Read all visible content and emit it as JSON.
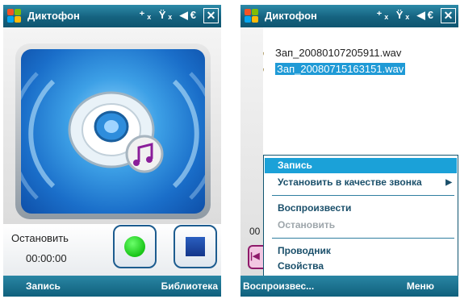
{
  "status_bar": {
    "app_title": "Диктофон",
    "icons": [
      "windows-start-icon",
      "connectivity-icon",
      "signal-off-icon",
      "volume-muted-icon",
      "close-icon"
    ],
    "status_glyphs": "⁺ₓ Ÿₓ ◀€",
    "close_glyph": "✕"
  },
  "left_screen": {
    "status_text": "Остановить",
    "elapsed_time": "00:00:00",
    "controls": {
      "record_icon": "record-dot-icon",
      "stop_icon": "stop-square-icon"
    },
    "softkeys": {
      "left": "Запись",
      "right": "Библиотека"
    }
  },
  "right_screen": {
    "files": [
      {
        "name": "Зап_20080107205911.wav",
        "selected": false
      },
      {
        "name": "Зап_20080715163151.wav",
        "selected": true
      }
    ],
    "peek_text": "00",
    "context_menu": {
      "items": [
        {
          "label": "Запись",
          "state": "highlighted"
        },
        {
          "label": "Установить в качестве звонка",
          "state": "normal",
          "submenu": true
        },
        {
          "label": "Воспроизвести",
          "state": "normal"
        },
        {
          "label": "Остановить",
          "state": "disabled"
        },
        {
          "label": "Проводник",
          "state": "normal"
        },
        {
          "label": "Свойства",
          "state": "normal"
        }
      ]
    },
    "softkeys": {
      "left": "Воспроизвес...",
      "right": "Меню"
    }
  },
  "colors": {
    "titlebar": "#15627f",
    "highlight": "#1ba1d8",
    "menu_text": "#1a4f6a",
    "record_green": "#17c417",
    "stop_blue": "#14368a"
  }
}
